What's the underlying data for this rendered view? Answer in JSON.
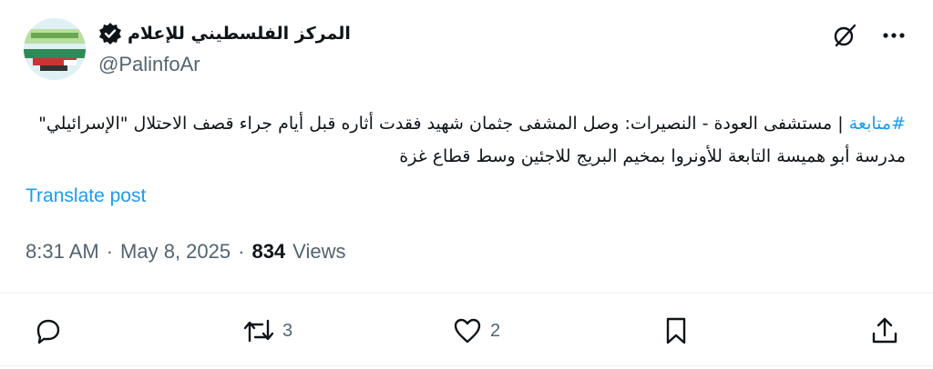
{
  "author": {
    "display_name": "المركز الفلسطيني للإعلام",
    "handle": "@PalinfoAr",
    "avatar_icon": "palinfo-logo",
    "verified_icon": "verified-badge-icon"
  },
  "tweet": {
    "hashtag": "#متابعة",
    "text": " | مستشفى العودة - النصيرات: وصل المشفى جثمان شهيد فقدت أثاره قبل أيام جراء قصف الاحتلال \"الإسرائيلي\" مدرسة أبو هميسة التابعة للأونروا بمخيم البريج للاجئين وسط قطاع غزة",
    "translate_label": "Translate post"
  },
  "meta": {
    "time": "8:31 AM",
    "sep1": "·",
    "date": "May 8, 2025",
    "sep2": "·",
    "views_count": "834",
    "views_label": "Views"
  },
  "actions": {
    "reply_count": "",
    "retweet_count": "3",
    "like_count": "2"
  },
  "colors": {
    "accent": "#1d9bf0",
    "text": "#0f1419",
    "secondary": "#536471"
  }
}
